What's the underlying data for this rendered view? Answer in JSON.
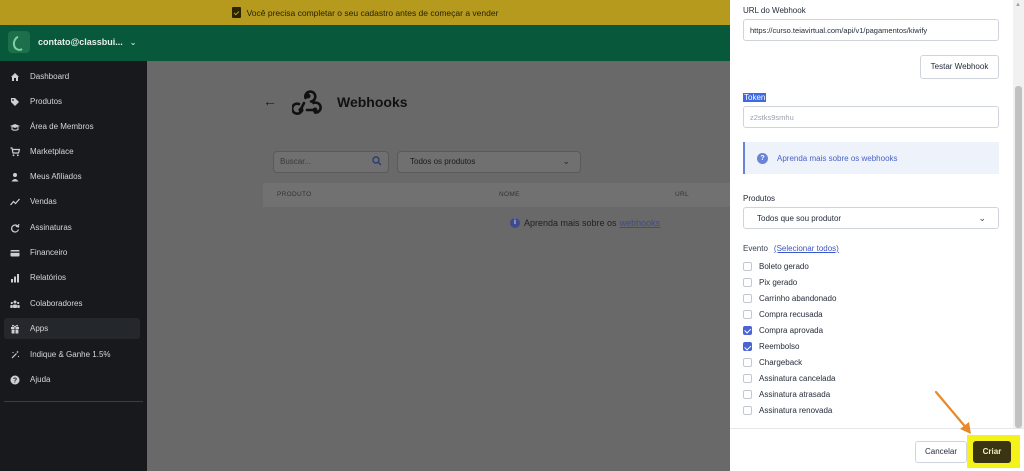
{
  "banner": {
    "text": "Você precisa completar o seu cadastro antes de começar a vender"
  },
  "account": {
    "email": "contato@classbui..."
  },
  "sidebar": {
    "items": [
      {
        "label": "Dashboard",
        "icon": "home-icon"
      },
      {
        "label": "Produtos",
        "icon": "tag-icon"
      },
      {
        "label": "Área de Membros",
        "icon": "graduation-cap-icon"
      },
      {
        "label": "Marketplace",
        "icon": "cart-icon"
      },
      {
        "label": "Meus Afiliados",
        "icon": "user-icon"
      },
      {
        "label": "Vendas",
        "icon": "trend-line-icon"
      },
      {
        "label": "Assinaturas",
        "icon": "refresh-icon"
      },
      {
        "label": "Financeiro",
        "icon": "credit-card-icon"
      },
      {
        "label": "Relatórios",
        "icon": "bar-chart-icon"
      },
      {
        "label": "Colaboradores",
        "icon": "users-icon"
      },
      {
        "label": "Apps",
        "icon": "gift-icon"
      },
      {
        "label": "Indique & Ganhe 1.5%",
        "icon": "sparkle-icon"
      },
      {
        "label": "Ajuda",
        "icon": "question-icon"
      }
    ],
    "active_index": 10
  },
  "main": {
    "title": "Webhooks",
    "search_placeholder": "Buscar...",
    "product_filter": "Todos os produtos",
    "columns": [
      "PRODUTO",
      "NOME",
      "URL"
    ],
    "learn_text": "Aprenda mais sobre os",
    "learn_link": "webhooks"
  },
  "drawer": {
    "url_label": "URL do Webhook",
    "url_value": "https://curso.teiavirtual.com/api/v1/pagamentos/kiwify",
    "test_button": "Testar Webhook",
    "token_label": "Token",
    "token_value": "z2stks9smhu",
    "info_text": "Aprenda mais sobre os webhooks",
    "products_label": "Produtos",
    "products_value": "Todos que sou produtor",
    "event_label": "Evento",
    "select_all": "(Selecionar todos)",
    "events": [
      {
        "label": "Boleto gerado",
        "checked": false
      },
      {
        "label": "Pix gerado",
        "checked": false
      },
      {
        "label": "Carrinho abandonado",
        "checked": false
      },
      {
        "label": "Compra recusada",
        "checked": false
      },
      {
        "label": "Compra aprovada",
        "checked": true
      },
      {
        "label": "Reembolso",
        "checked": true
      },
      {
        "label": "Chargeback",
        "checked": false
      },
      {
        "label": "Assinatura cancelada",
        "checked": false
      },
      {
        "label": "Assinatura atrasada",
        "checked": false
      },
      {
        "label": "Assinatura renovada",
        "checked": false
      }
    ],
    "cancel_button": "Cancelar",
    "create_button": "Criar"
  },
  "colors": {
    "banner": "#b59a1d",
    "header": "#08593b",
    "sidebar": "#17191c",
    "accent": "#4a63d6",
    "highlight": "#f5f21a",
    "annotation_arrow": "#e8892b"
  }
}
